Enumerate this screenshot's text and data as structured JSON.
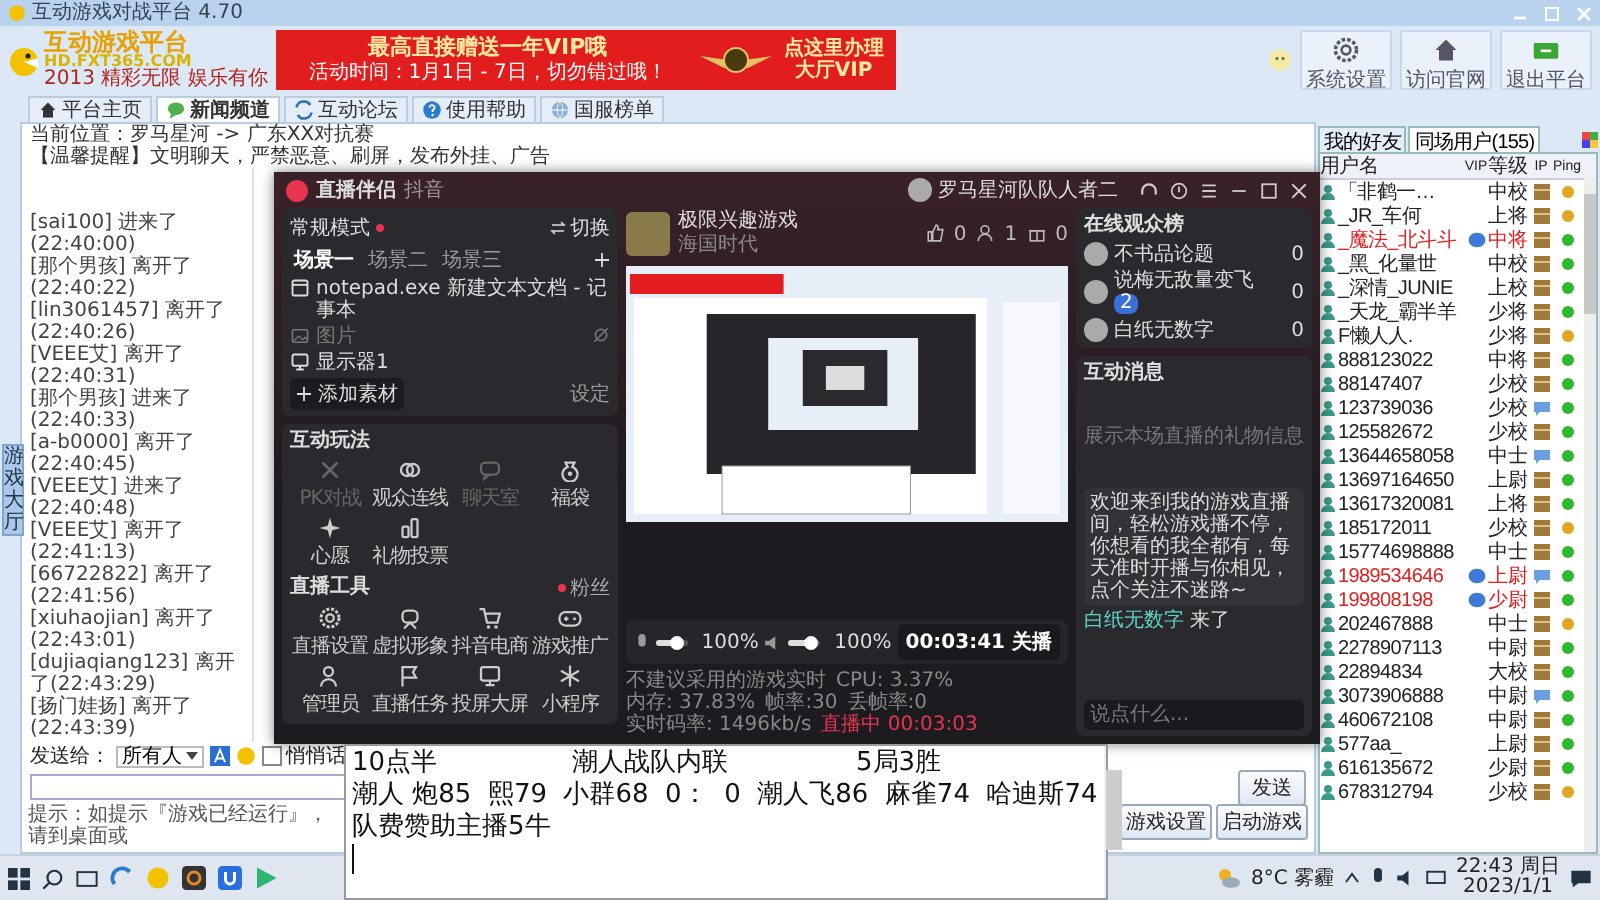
{
  "window": {
    "title": "互动游戏对战平台 4.70"
  },
  "logo": {
    "title": "互动游戏平台",
    "domain": "HD.FXT365.COM",
    "slogan": "2013 精彩无限 娱乐有你"
  },
  "banner": {
    "headline": "最高直接赠送一年VIP哦",
    "period": "活动时间：1月1日 - 7日，切勿错过哦！",
    "action": "点这里办理",
    "product": "大厅VIP"
  },
  "toolbar": [
    {
      "label": "系统设置",
      "kind": "gear"
    },
    {
      "label": "访问官网",
      "kind": "home"
    },
    {
      "label": "退出平台",
      "kind": "exit"
    }
  ],
  "tabs": [
    {
      "label": "平台主页",
      "kind": "home",
      "selected": false
    },
    {
      "label": "新闻频道",
      "kind": "news",
      "selected": true
    },
    {
      "label": "互动论坛",
      "kind": "forum",
      "selected": false
    },
    {
      "label": "使用帮助",
      "kind": "help",
      "selected": false
    },
    {
      "label": "国服榜单",
      "kind": "rank",
      "selected": false
    }
  ],
  "location": "当前位置：罗马星河 -> 广东XX对抗赛",
  "notice": "【温馨提醒】文明聊天，严禁恶意、刷屏，发布外挂、广告",
  "side_tab": "游戏大厅",
  "chat_log": [
    {
      "user": "[sai100]",
      "event": "进来了(22:40:00)"
    },
    {
      "user": "[那个男孩]",
      "event": "离开了(22:40:22)"
    },
    {
      "user": "[lin3061457]",
      "event": "离开了(22:40:26)"
    },
    {
      "user": "[VEEE艾]",
      "event": "离开了(22:40:31)"
    },
    {
      "user": "[那个男孩]",
      "event": "进来了(22:40:33)"
    },
    {
      "user": "[a-b0000]",
      "event": "离开了(22:40:45)"
    },
    {
      "user": "[VEEE艾]",
      "event": "进来了(22:40:48)"
    },
    {
      "user": "[VEEE艾]",
      "event": "离开了(22:41:13)"
    },
    {
      "user": "[66722822]",
      "event": "离开了(22:41:56)"
    },
    {
      "user": "[xiuhaojian]",
      "event": "离开了(22:43:01)"
    },
    {
      "user": "[dujiaqiang123]",
      "event": "离开了(22:43:29)"
    },
    {
      "user": "[扬门娃扬]",
      "event": "离开了(22:43:39)"
    }
  ],
  "send": {
    "to_label": "发送给：",
    "to_value": "所有人",
    "whisper": {
      "label": "悄悄话",
      "checked": false
    },
    "button": "发送"
  },
  "hint": "提示：如提示『游戏已经运行』，请到桌面或",
  "game_buttons": [
    "游戏设置",
    "启动游戏"
  ],
  "users": {
    "tabs": [
      {
        "label": "我的好友",
        "selected": false
      },
      {
        "label": "同场用户(155)",
        "selected": true
      }
    ],
    "columns": [
      "用户名",
      "VIP",
      "等级",
      "IP",
      "Ping"
    ],
    "rows": [
      {
        "name": "「非鹤一…",
        "rank": "中校",
        "vip": false,
        "kind": "box",
        "color": "#e0a81c"
      },
      {
        "name": "_JR_车何",
        "rank": "上将",
        "vip": false,
        "kind": "box",
        "color": "#e0a81c"
      },
      {
        "name": "_魔法_北斗斗",
        "rank": "中将",
        "vip": true,
        "kind": "box",
        "color": "#2eb82e"
      },
      {
        "name": "_黑_化量世",
        "rank": "中校",
        "vip": false,
        "kind": "box",
        "color": "#2eb82e"
      },
      {
        "name": "_深情_JUNIE",
        "rank": "上校",
        "vip": false,
        "kind": "box",
        "color": "#2eb82e"
      },
      {
        "name": "_天龙_霸半羊",
        "rank": "少将",
        "vip": false,
        "kind": "box",
        "color": "#2eb82e"
      },
      {
        "name": "F懒人人.",
        "rank": "少将",
        "vip": false,
        "kind": "box",
        "color": "#e0a81c"
      },
      {
        "name": "888123022",
        "rank": "中将",
        "vip": false,
        "kind": "box",
        "color": "#2eb82e"
      },
      {
        "name": "88147407",
        "rank": "少校",
        "vip": false,
        "kind": "box",
        "color": "#2eb82e"
      },
      {
        "name": "123739036",
        "rank": "少校",
        "vip": false,
        "kind": "chat",
        "color": "#2eb82e"
      },
      {
        "name": "125582672",
        "rank": "少校",
        "vip": false,
        "kind": "box",
        "color": "#2eb82e"
      },
      {
        "name": "13644658058",
        "rank": "中士",
        "vip": false,
        "kind": "chat",
        "color": "#2eb82e"
      },
      {
        "name": "13697164650",
        "rank": "上尉",
        "vip": false,
        "kind": "box",
        "color": "#2eb82e"
      },
      {
        "name": "13617320081",
        "rank": "上将",
        "vip": false,
        "kind": "box",
        "color": "#2eb82e"
      },
      {
        "name": "185172011",
        "rank": "少校",
        "vip": false,
        "kind": "box",
        "color": "#e0a81c"
      },
      {
        "name": "15774698888",
        "rank": "中士",
        "vip": false,
        "kind": "box",
        "color": "#2eb82e"
      },
      {
        "name": "1989534646",
        "rank": "上尉",
        "vip": true,
        "kind": "chat",
        "color": "#2eb82e"
      },
      {
        "name": "199808198",
        "rank": "少尉",
        "vip": true,
        "kind": "box",
        "color": "#2eb82e"
      },
      {
        "name": "202467888",
        "rank": "中士",
        "vip": false,
        "kind": "box",
        "color": "#e0a81c"
      },
      {
        "name": "2278907113",
        "rank": "中尉",
        "vip": false,
        "kind": "box",
        "color": "#2eb82e"
      },
      {
        "name": "22894834",
        "rank": "大校",
        "vip": false,
        "kind": "box",
        "color": "#2eb82e"
      },
      {
        "name": "3073906888",
        "rank": "中尉",
        "vip": false,
        "kind": "chat",
        "color": "#2eb82e"
      },
      {
        "name": "460672108",
        "rank": "中尉",
        "vip": false,
        "kind": "box",
        "color": "#2eb82e"
      },
      {
        "name": "577aa_",
        "rank": "上尉",
        "vip": false,
        "kind": "box",
        "color": "#2eb82e"
      },
      {
        "name": "616135672",
        "rank": "少尉",
        "vip": false,
        "kind": "box",
        "color": "#2eb82e"
      },
      {
        "name": "678312794",
        "rank": "少校",
        "vip": false,
        "kind": "box",
        "color": "#e0a81c"
      }
    ]
  },
  "stream": {
    "app": "直播伴侣",
    "platform": "抖音",
    "account": "罗马星河队队人者二",
    "mode": "常规模式",
    "switch": "切换",
    "scenes": [
      {
        "label": "场景一",
        "selected": true
      },
      {
        "label": "场景二",
        "selected": false
      },
      {
        "label": "场景三",
        "selected": false
      }
    ],
    "sources": [
      {
        "label": "notepad.exe 新建文本文档 - 记事本",
        "kind": "window",
        "hidden": false
      },
      {
        "label": "图片",
        "kind": "image",
        "hidden": true
      },
      {
        "label": "显示器1",
        "kind": "monitor",
        "hidden": false
      }
    ],
    "add_source": "添加素材",
    "settings": "设定",
    "interactive": {
      "title": "互动玩法",
      "items": [
        {
          "label": "PK对战",
          "kind": "pk",
          "disabled": true
        },
        {
          "label": "观众连线",
          "kind": "link",
          "disabled": false
        },
        {
          "label": "聊天室",
          "kind": "chat",
          "disabled": true
        },
        {
          "label": "福袋",
          "kind": "bag",
          "disabled": false
        },
        {
          "label": "心愿",
          "kind": "wish",
          "disabled": false
        },
        {
          "label": "礼物投票",
          "kind": "vote",
          "disabled": false
        }
      ]
    },
    "tools": {
      "title": "直播工具",
      "fans": "粉丝",
      "items": [
        {
          "label": "直播设置",
          "kind": "gear"
        },
        {
          "label": "虚拟形象",
          "kind": "avatar"
        },
        {
          "label": "抖音电商",
          "kind": "cart"
        },
        {
          "label": "游戏推广",
          "kind": "game"
        },
        {
          "label": "管理员",
          "kind": "admin"
        },
        {
          "label": "直播任务",
          "kind": "task"
        },
        {
          "label": "投屏大屏",
          "kind": "monitor"
        },
        {
          "label": "小程序",
          "kind": "mini"
        }
      ]
    },
    "room": {
      "title": "极限兴趣游戏",
      "category": "海国时代",
      "likes": "0",
      "viewers": "1",
      "gifts": "0"
    },
    "mic": {
      "level": 0.72,
      "reading": "100%"
    },
    "speaker": {
      "level": 0.72,
      "reading": "100%"
    },
    "timer": "00:03:41 关播",
    "hint": "不建议采用的游戏实时",
    "stats": [
      "CPU: 3.37%",
      "内存: 37.83%",
      "帧率:30",
      "丢帧率:0",
      "实时码率: 1496kb/s"
    ],
    "live": "直播中 00:03:03",
    "audience": {
      "title": "在线观众榜",
      "viewers": [
        {
          "name": "不书品论题",
          "score": "0"
        },
        {
          "name": "说梅无敌量变飞",
          "score": "0",
          "badge": "2"
        },
        {
          "name": "白纸无数字",
          "score": "0"
        }
      ]
    },
    "messages": {
      "title": "互动消息",
      "empty": "展示本场直播的礼物信息",
      "welcome": "欢迎来到我的游戏直播间，轻松游戏播不停，你想看的我全都有，每天准时开播与你相见，点个关注不迷路~",
      "join_name": "白纸无数字",
      "join_action": "来了",
      "placeholder": "说点什么..."
    }
  },
  "notepad": {
    "lines": [
      [
        "10点半",
        "潮人战队内联",
        "5局3胜"
      ],
      [
        "潮人 炮85  熙79  小群68  0：  0  潮人飞86  麻雀74  哈迪斯74"
      ],
      [
        "队费赞助主播5牛"
      ]
    ]
  },
  "taskbar": {
    "weather": "8°C 雾霾",
    "time": "22:43 周日",
    "date": "2023/1/1"
  }
}
